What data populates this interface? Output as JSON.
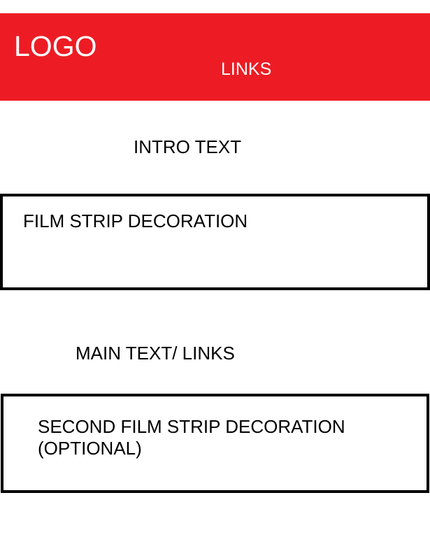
{
  "colors": {
    "header_background": "#ed1c24",
    "header_text": "#ffffff",
    "page_background": "#ffffff",
    "outline": "#000000"
  },
  "header": {
    "logo": "LOGO",
    "links": "LINKS"
  },
  "intro": {
    "text": "INTRO TEXT"
  },
  "film_strip_1": {
    "text": "FILM STRIP DECORATION"
  },
  "main": {
    "text": "MAIN TEXT/ LINKS"
  },
  "film_strip_2": {
    "line1": "SECOND FILM STRIP DECORATION",
    "line2": "(OPTIONAL)"
  }
}
